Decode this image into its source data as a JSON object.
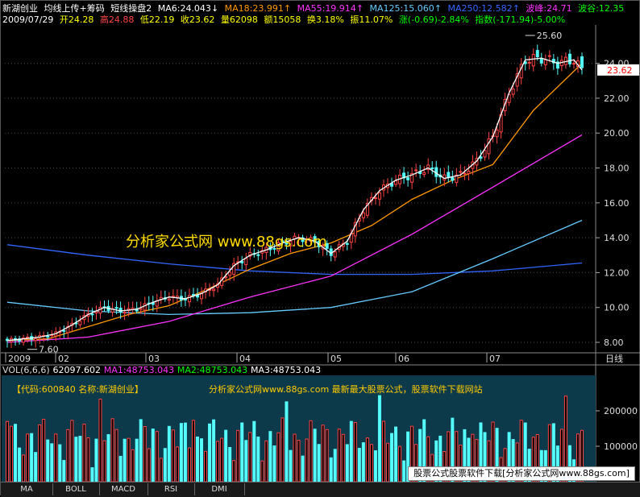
{
  "header": {
    "stock_name": "新湖创业",
    "indicator_name": "均线上传+筹码",
    "panel_name": "短线操盘2",
    "ma_values": [
      {
        "label": "MA6:24.043",
        "arrow": "↓",
        "color": "#ffffff"
      },
      {
        "label": "MA18:23.991",
        "arrow": "↑",
        "color": "#ff9900"
      },
      {
        "label": "MA55:19.914",
        "arrow": "↑",
        "color": "#ff33ff"
      },
      {
        "label": "MA125:15.060",
        "arrow": "↑",
        "color": "#66ccff"
      },
      {
        "label": "MA250:12.582",
        "arrow": "↑",
        "color": "#3366ff"
      }
    ],
    "wave_peak": "波峰:24.71",
    "wave_trough": "波谷:12.35"
  },
  "quote": {
    "date": "2009/07/29",
    "open": "开24.28",
    "high": "高24.88",
    "low": "低22.19",
    "close": "收23.62",
    "volume": "量62098",
    "amount": "额15058",
    "turnover": "换3.18%",
    "amplitude": "振11.07%",
    "change": "涨(-0.69)-2.84%",
    "index": "指数(-171.94)-5.00%"
  },
  "chart_data": [
    {
      "type": "candlestick",
      "ylabel": "",
      "ylim": [
        7.4,
        26.2
      ],
      "y_ticks": [
        "24.00",
        "22.00",
        "20.00",
        "18.00",
        "16.00",
        "14.00",
        "12.00",
        "10.00",
        "8.00"
      ],
      "x_tick_labels": [
        "2009",
        "02",
        "03",
        "04",
        "05",
        "06",
        "07",
        "日线"
      ],
      "last_price_tag": "23.62",
      "max_label": "25.60",
      "min_label": "7.60",
      "watermark": "分析家公式网 www.88gs.com",
      "series": [
        {
          "name": "MA6",
          "color": "#ffffff"
        },
        {
          "name": "MA18",
          "color": "#ff9900"
        },
        {
          "name": "MA55",
          "color": "#ff33ff"
        },
        {
          "name": "MA125",
          "color": "#66ccff"
        },
        {
          "name": "MA250",
          "color": "#3366ff"
        }
      ],
      "close_path": [
        [
          0,
          8.1
        ],
        [
          4,
          8.2
        ],
        [
          8,
          8.3
        ],
        [
          12,
          8.5
        ],
        [
          16,
          9.0
        ],
        [
          20,
          9.6
        ],
        [
          24,
          10.0
        ],
        [
          28,
          9.8
        ],
        [
          32,
          9.9
        ],
        [
          36,
          10.3
        ],
        [
          40,
          10.6
        ],
        [
          44,
          10.5
        ],
        [
          48,
          10.8
        ],
        [
          52,
          11.3
        ],
        [
          56,
          12.4
        ],
        [
          60,
          13.0
        ],
        [
          64,
          13.3
        ],
        [
          68,
          13.7
        ],
        [
          72,
          14.0
        ],
        [
          76,
          13.8
        ],
        [
          80,
          13.1
        ],
        [
          84,
          13.8
        ],
        [
          88,
          15.6
        ],
        [
          92,
          16.7
        ],
        [
          96,
          17.3
        ],
        [
          100,
          17.6
        ],
        [
          104,
          18.0
        ],
        [
          108,
          17.4
        ],
        [
          112,
          17.6
        ],
        [
          116,
          18.4
        ],
        [
          120,
          19.8
        ],
        [
          124,
          22.3
        ],
        [
          128,
          24.2
        ],
        [
          132,
          24.3
        ],
        [
          136,
          24.0
        ],
        [
          140,
          24.2
        ],
        [
          142,
          23.62
        ]
      ]
    },
    {
      "type": "bar",
      "title": "VOL(6,6,6)",
      "values_label": "62097.602",
      "ma_labels": [
        "MA1:48753.043",
        "MA2:48753.043",
        "MA3:48753.043"
      ],
      "y_ticks": [
        "200000",
        "100000"
      ],
      "ylim": [
        0,
        300000
      ],
      "code_label": "【代码:600840 名称:新湖创业】",
      "banner": "分析家公式网www.88gs.com 最新最大股票公式，股票软件下载网站",
      "footer": "股票公式股票软件下载[分析家公式网www.88gs.com]"
    }
  ],
  "tabs": [
    "MA",
    "BOLL",
    "MACD",
    "RSI",
    "DMI"
  ]
}
